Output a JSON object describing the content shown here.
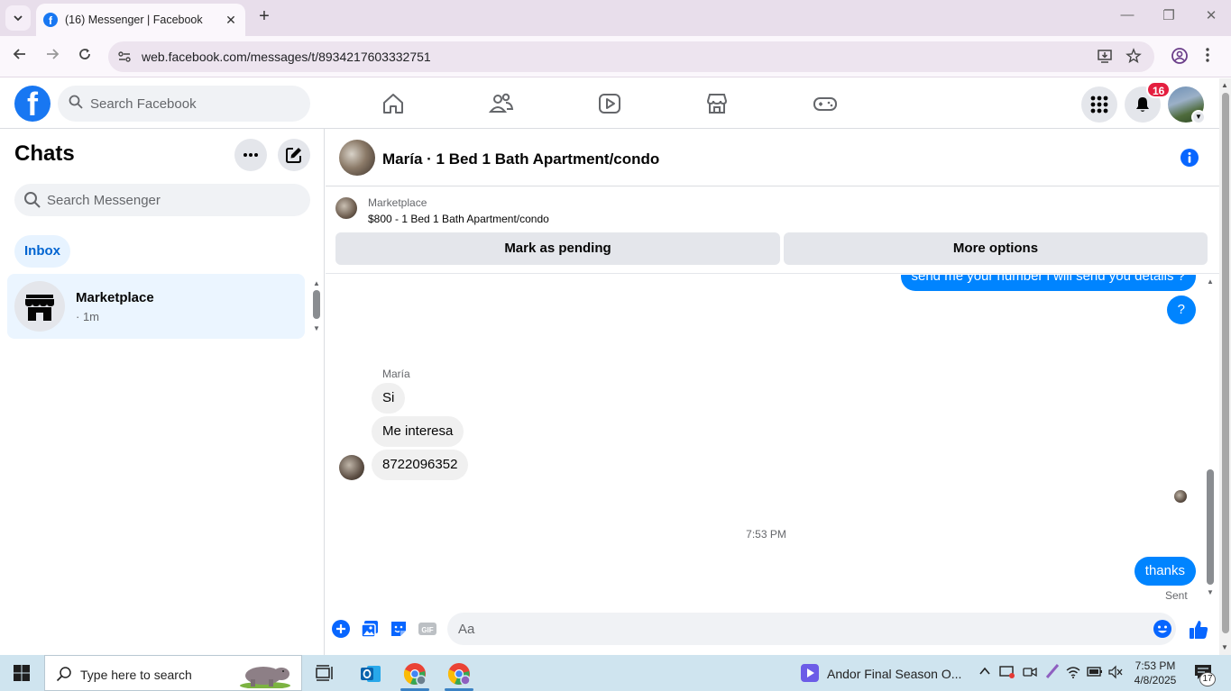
{
  "browser": {
    "tab_title": "(16) Messenger | Facebook",
    "url": "web.facebook.com/messages/t/8934217603332751",
    "window_controls": {
      "minimize": "—",
      "restore": "❐",
      "close": "✕"
    }
  },
  "fb": {
    "logo_letter": "f",
    "search_placeholder": "Search Facebook",
    "nav_icons": [
      "home-icon",
      "friends-icon",
      "watch-icon",
      "marketplace-icon",
      "gaming-icon"
    ],
    "notification_count": "16",
    "brand_color": "#1877f2"
  },
  "left": {
    "title": "Chats",
    "search_placeholder": "Search Messenger",
    "filter_chip": "Inbox",
    "chats": [
      {
        "name": "Marketplace",
        "time": "· 1m"
      }
    ]
  },
  "conversation": {
    "title": "María · 1 Bed 1 Bath Apartment/condo",
    "marketplace_label": "Marketplace",
    "listing": "$800 - 1 Bed 1 Bath Apartment/condo",
    "btn_pending": "Mark as pending",
    "btn_more": "More options",
    "messages": {
      "out1": "send me your number i will send you details ?",
      "out2": "?",
      "sender": "María",
      "in1": "Si",
      "in2": "Me interesa",
      "in3": "8722096352",
      "timestamp": "7:53 PM",
      "out3": "thanks",
      "status": "Sent"
    },
    "composer_placeholder": "Aa",
    "bubble_color": "#0084ff"
  },
  "taskbar": {
    "search_placeholder": "Type here to search",
    "media_title": "Andor Final Season O...",
    "time": "7:53 PM",
    "date": "4/8/2025",
    "notification_count": "17"
  }
}
